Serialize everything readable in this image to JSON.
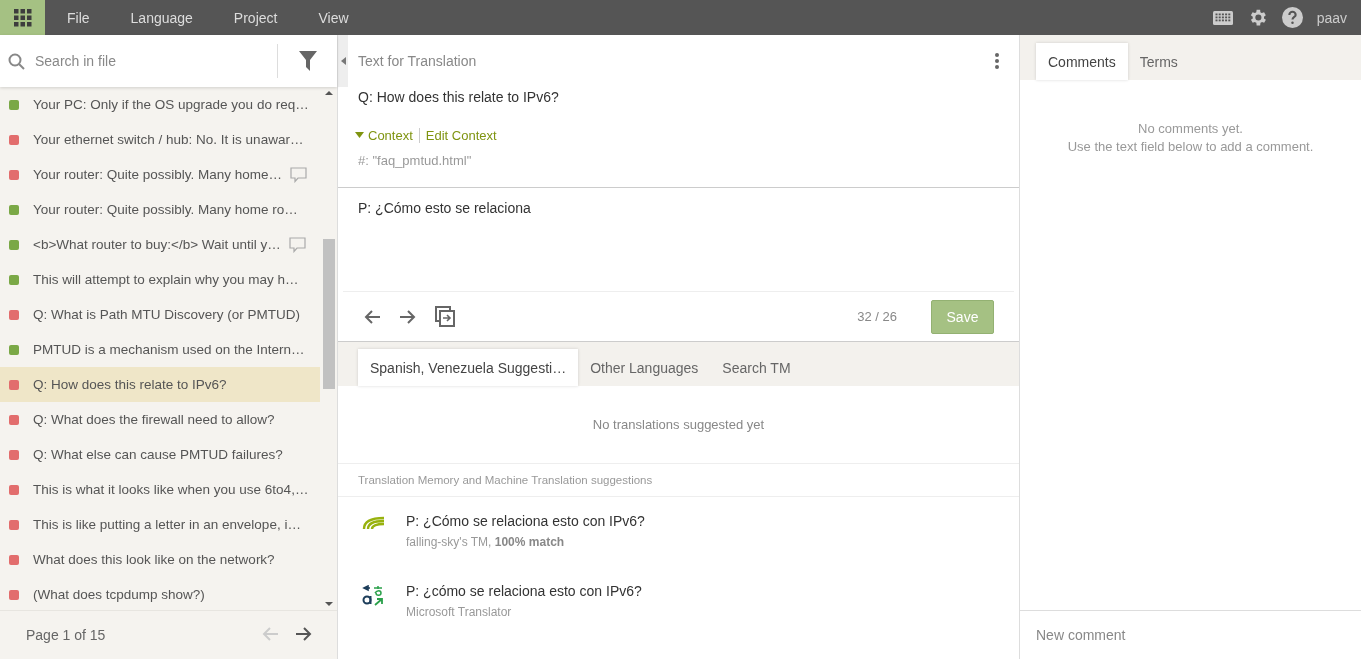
{
  "menu": {
    "items": [
      "File",
      "Language",
      "Project",
      "View"
    ],
    "user": "paav"
  },
  "search": {
    "placeholder": "Search in file"
  },
  "strings": [
    {
      "text": "Your PC: Only if the OS upgrade you do req…",
      "color": "#7aa846",
      "has_comment": false,
      "selected": false
    },
    {
      "text": "Your ethernet switch / hub: No. It is unawar…",
      "color": "#e26d6d",
      "has_comment": false,
      "selected": false
    },
    {
      "text": "Your router: Quite possibly. Many home…",
      "color": "#e26d6d",
      "has_comment": true,
      "selected": false
    },
    {
      "text": "Your router: Quite possibly. Many home ro…",
      "color": "#7aa846",
      "has_comment": false,
      "selected": false
    },
    {
      "text": "<b>What router to buy:</b> Wait until y…",
      "color": "#7aa846",
      "has_comment": true,
      "selected": false
    },
    {
      "text": "This will attempt to explain why you may h…",
      "color": "#7aa846",
      "has_comment": false,
      "selected": false
    },
    {
      "text": "Q: What is Path MTU Discovery (or PMTUD)",
      "color": "#e26d6d",
      "has_comment": false,
      "selected": false
    },
    {
      "text": "PMTUD is a mechanism used on the Intern…",
      "color": "#7aa846",
      "has_comment": false,
      "selected": false
    },
    {
      "text": "Q: How does this relate to IPv6?",
      "color": "#e26d6d",
      "has_comment": false,
      "selected": true
    },
    {
      "text": "Q: What does the firewall need to allow?",
      "color": "#e26d6d",
      "has_comment": false,
      "selected": false
    },
    {
      "text": "Q: What else can cause PMTUD failures?",
      "color": "#e26d6d",
      "has_comment": false,
      "selected": false
    },
    {
      "text": "This is what it looks like when you use 6to4,…",
      "color": "#e26d6d",
      "has_comment": false,
      "selected": false
    },
    {
      "text": "This is like putting a letter in an envelope, i…",
      "color": "#e26d6d",
      "has_comment": false,
      "selected": false
    },
    {
      "text": "What does this look like on the network?",
      "color": "#e26d6d",
      "has_comment": false,
      "selected": false
    },
    {
      "text": "(What does tcpdump show?)",
      "color": "#e26d6d",
      "has_comment": false,
      "selected": false
    }
  ],
  "pager": {
    "label": "Page 1 of 15",
    "prev_disabled": true,
    "next_disabled": false
  },
  "editor": {
    "title": "Text for Translation",
    "source": "Q: How does this relate to IPv6?",
    "context_toggle": "Context",
    "context_expanded": true,
    "edit_context": "Edit Context",
    "context": "#: \"faq_pmtud.html\"",
    "translation": "P: ¿Cómo esto se relaciona",
    "counter": "32 / 26",
    "save": "Save"
  },
  "suggestion_tabs": [
    {
      "label": "Spanish, Venezuela Suggesti…",
      "selected": true
    },
    {
      "label": "Other Languages",
      "selected": false
    },
    {
      "label": "Search TM",
      "selected": false
    }
  ],
  "no_suggestions": "No translations suggested yet",
  "machine_header": "Translation Memory and Machine Translation suggestions",
  "machine_suggestions": [
    {
      "kind": "tm",
      "text": "P: ¿Cómo se relaciona esto con IPv6?",
      "source": "falling-sky's TM, **100% match**"
    },
    {
      "kind": "mt",
      "text": "P: ¿cómo se relaciona esto con IPv6?",
      "source": "Microsoft Translator"
    }
  ],
  "side_tabs": [
    {
      "label": "Comments",
      "selected": true
    },
    {
      "label": "Terms",
      "selected": false
    }
  ],
  "comments_empty": [
    "No comments yet.",
    "Use the text field below to add a comment."
  ],
  "comment_field": {
    "placeholder": "New comment"
  }
}
